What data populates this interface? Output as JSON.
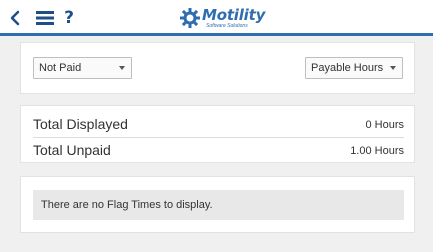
{
  "header": {
    "back_icon": "chevron-left-icon",
    "menu_icon": "hamburger-menu-icon",
    "help_label": "?",
    "logo": {
      "name": "Motility",
      "tagline": "Software Solutions"
    },
    "accent_color": "#2f6db1"
  },
  "filters": {
    "status_selected": "Not Paid",
    "hours_selected": "Payable Hours"
  },
  "totals": [
    {
      "label": "Total Displayed",
      "value": "0 Hours"
    },
    {
      "label": "Total Unpaid",
      "value": "1.00 Hours"
    }
  ],
  "flags": {
    "empty_message": "There are no Flag Times to display."
  }
}
